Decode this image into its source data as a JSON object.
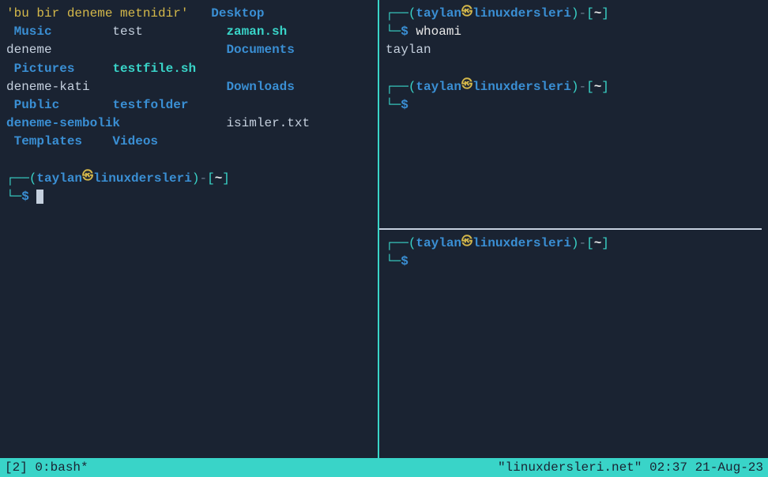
{
  "left_pane": {
    "ls": {
      "r1c1": "'bu bir deneme metnidir'",
      "r1c2": "Desktop",
      "r2c1": " Music",
      "r2c2": "test",
      "r2c3": " zaman.sh",
      "r3c1": "deneme",
      "r3c2": "Documents",
      "r4c1": " Pictures",
      "r4c2": "testfile.sh",
      "r5c1": "deneme-kati",
      "r5c2": "Downloads",
      "r6c1": " Public",
      "r6c2": "testfolder",
      "r7c1": "deneme-sembolik",
      "r7c2": "isimler.txt",
      "r8c1": " Templates",
      "r8c2": "Videos"
    }
  },
  "right_top": {
    "cmd": "whoami",
    "output": "taylan"
  },
  "prompt": {
    "user": "taylan",
    "at": "㉿",
    "host": "linuxdersleri",
    "path": "~",
    "corner_top": "┌──",
    "corner_bot": "└─",
    "open": "(",
    "close": ")",
    "dash": "-",
    "lbrack": "[",
    "rbrack": "]",
    "dollar": "$"
  },
  "status": {
    "left": "[2] 0:bash*",
    "right": "\"linuxdersleri.net\" 02:37 21-Aug-23"
  }
}
